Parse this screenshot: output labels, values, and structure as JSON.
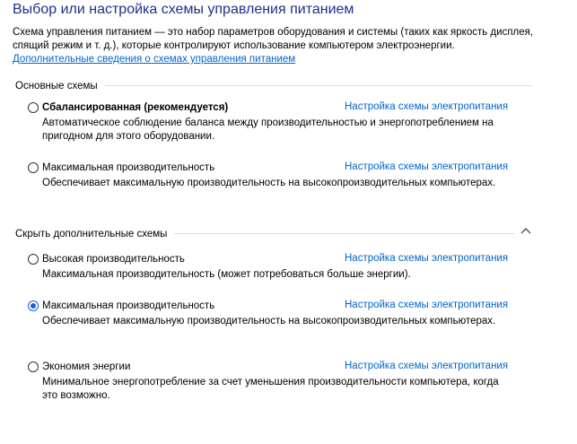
{
  "header": {
    "title": "Выбор или настройка схемы управления питанием",
    "description": "Схема управления питанием — это набор параметров оборудования и системы (таких как яркость дисплея, спящий режим и т. д.), которые контролируют использование компьютером электроэнергии.",
    "more_info_link": "Дополнительные сведения о схемах управления питанием"
  },
  "main_group": {
    "label": "Основные схемы",
    "plans": [
      {
        "name": "Сбалансированная (рекомендуется)",
        "selected": false,
        "settings_link": "Настройка схемы электропитания",
        "description": "Автоматическое соблюдение баланса между производительностью и энергопотреблением на пригодном для этого оборудовании."
      },
      {
        "name": "Максимальная производительность",
        "selected": false,
        "settings_link": "Настройка схемы электропитания",
        "description": "Обеспечивает максимальную производительность на высокопроизводительных компьютерах."
      }
    ]
  },
  "extra_group": {
    "label": "Скрыть дополнительные схемы",
    "toggle_icon": "chevron-up-icon",
    "plans": [
      {
        "name": "Высокая производительность",
        "selected": false,
        "settings_link": "Настройка схемы электропитания",
        "description": "Максимальная производительность (может потребоваться больше энергии)."
      },
      {
        "name": "Максимальная производительность",
        "selected": true,
        "settings_link": "Настройка схемы электропитания",
        "description": "Обеспечивает максимальную производительность на высокопроизводительных компьютерах."
      },
      {
        "name": "Экономия энергии",
        "selected": false,
        "settings_link": "Настройка схемы электропитания",
        "description": "Минимальное энергопотребление за счет уменьшения производительности компьютера, когда это возможно."
      }
    ]
  },
  "colors": {
    "title": "#1e3287",
    "link": "#0066cc",
    "radio_selected": "#1e5fd0"
  }
}
